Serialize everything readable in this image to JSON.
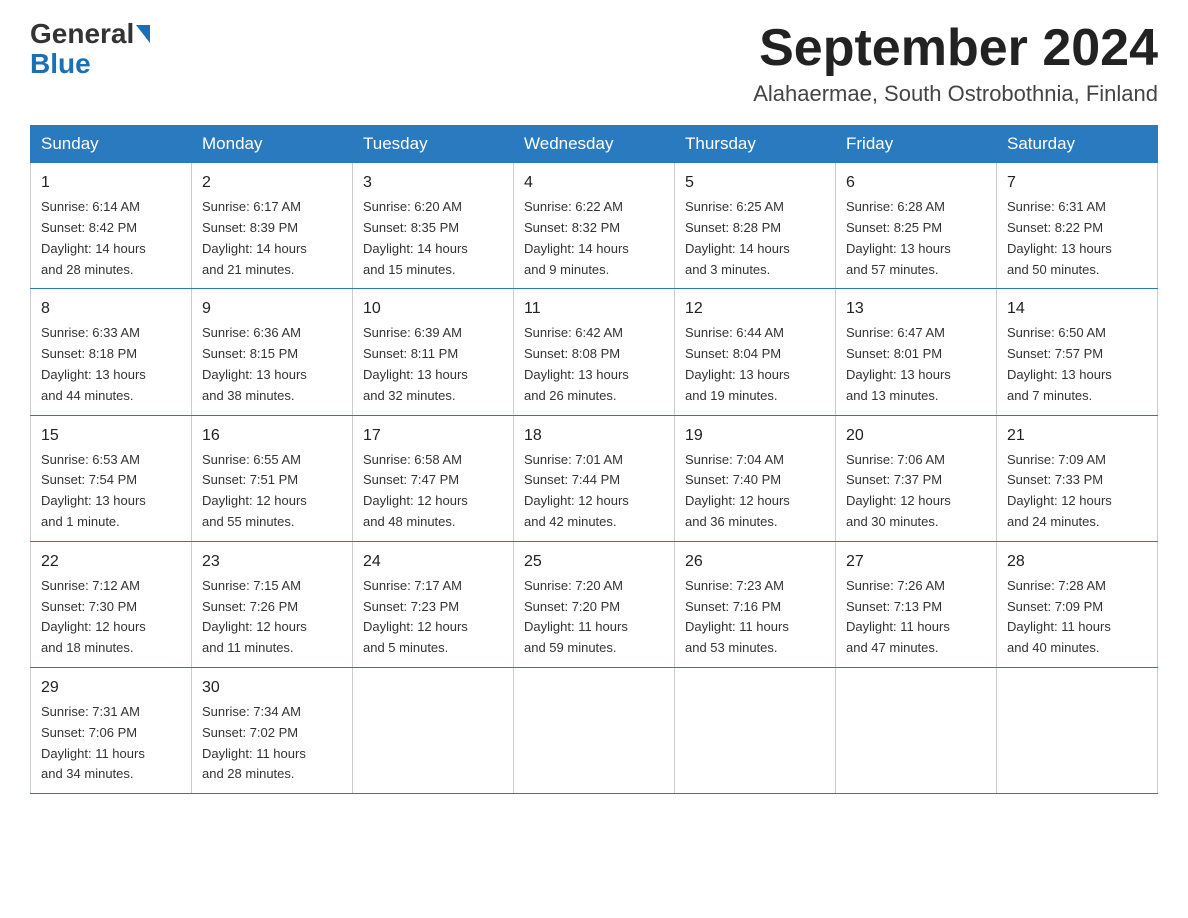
{
  "header": {
    "logo_general": "General",
    "logo_blue": "Blue",
    "month_title": "September 2024",
    "location": "Alahaermae, South Ostrobothnia, Finland"
  },
  "days_of_week": [
    "Sunday",
    "Monday",
    "Tuesday",
    "Wednesday",
    "Thursday",
    "Friday",
    "Saturday"
  ],
  "weeks": [
    [
      {
        "day": "1",
        "sunrise": "6:14 AM",
        "sunset": "8:42 PM",
        "daylight": "14 hours and 28 minutes."
      },
      {
        "day": "2",
        "sunrise": "6:17 AM",
        "sunset": "8:39 PM",
        "daylight": "14 hours and 21 minutes."
      },
      {
        "day": "3",
        "sunrise": "6:20 AM",
        "sunset": "8:35 PM",
        "daylight": "14 hours and 15 minutes."
      },
      {
        "day": "4",
        "sunrise": "6:22 AM",
        "sunset": "8:32 PM",
        "daylight": "14 hours and 9 minutes."
      },
      {
        "day": "5",
        "sunrise": "6:25 AM",
        "sunset": "8:28 PM",
        "daylight": "14 hours and 3 minutes."
      },
      {
        "day": "6",
        "sunrise": "6:28 AM",
        "sunset": "8:25 PM",
        "daylight": "13 hours and 57 minutes."
      },
      {
        "day": "7",
        "sunrise": "6:31 AM",
        "sunset": "8:22 PM",
        "daylight": "13 hours and 50 minutes."
      }
    ],
    [
      {
        "day": "8",
        "sunrise": "6:33 AM",
        "sunset": "8:18 PM",
        "daylight": "13 hours and 44 minutes."
      },
      {
        "day": "9",
        "sunrise": "6:36 AM",
        "sunset": "8:15 PM",
        "daylight": "13 hours and 38 minutes."
      },
      {
        "day": "10",
        "sunrise": "6:39 AM",
        "sunset": "8:11 PM",
        "daylight": "13 hours and 32 minutes."
      },
      {
        "day": "11",
        "sunrise": "6:42 AM",
        "sunset": "8:08 PM",
        "daylight": "13 hours and 26 minutes."
      },
      {
        "day": "12",
        "sunrise": "6:44 AM",
        "sunset": "8:04 PM",
        "daylight": "13 hours and 19 minutes."
      },
      {
        "day": "13",
        "sunrise": "6:47 AM",
        "sunset": "8:01 PM",
        "daylight": "13 hours and 13 minutes."
      },
      {
        "day": "14",
        "sunrise": "6:50 AM",
        "sunset": "7:57 PM",
        "daylight": "13 hours and 7 minutes."
      }
    ],
    [
      {
        "day": "15",
        "sunrise": "6:53 AM",
        "sunset": "7:54 PM",
        "daylight": "13 hours and 1 minute."
      },
      {
        "day": "16",
        "sunrise": "6:55 AM",
        "sunset": "7:51 PM",
        "daylight": "12 hours and 55 minutes."
      },
      {
        "day": "17",
        "sunrise": "6:58 AM",
        "sunset": "7:47 PM",
        "daylight": "12 hours and 48 minutes."
      },
      {
        "day": "18",
        "sunrise": "7:01 AM",
        "sunset": "7:44 PM",
        "daylight": "12 hours and 42 minutes."
      },
      {
        "day": "19",
        "sunrise": "7:04 AM",
        "sunset": "7:40 PM",
        "daylight": "12 hours and 36 minutes."
      },
      {
        "day": "20",
        "sunrise": "7:06 AM",
        "sunset": "7:37 PM",
        "daylight": "12 hours and 30 minutes."
      },
      {
        "day": "21",
        "sunrise": "7:09 AM",
        "sunset": "7:33 PM",
        "daylight": "12 hours and 24 minutes."
      }
    ],
    [
      {
        "day": "22",
        "sunrise": "7:12 AM",
        "sunset": "7:30 PM",
        "daylight": "12 hours and 18 minutes."
      },
      {
        "day": "23",
        "sunrise": "7:15 AM",
        "sunset": "7:26 PM",
        "daylight": "12 hours and 11 minutes."
      },
      {
        "day": "24",
        "sunrise": "7:17 AM",
        "sunset": "7:23 PM",
        "daylight": "12 hours and 5 minutes."
      },
      {
        "day": "25",
        "sunrise": "7:20 AM",
        "sunset": "7:20 PM",
        "daylight": "11 hours and 59 minutes."
      },
      {
        "day": "26",
        "sunrise": "7:23 AM",
        "sunset": "7:16 PM",
        "daylight": "11 hours and 53 minutes."
      },
      {
        "day": "27",
        "sunrise": "7:26 AM",
        "sunset": "7:13 PM",
        "daylight": "11 hours and 47 minutes."
      },
      {
        "day": "28",
        "sunrise": "7:28 AM",
        "sunset": "7:09 PM",
        "daylight": "11 hours and 40 minutes."
      }
    ],
    [
      {
        "day": "29",
        "sunrise": "7:31 AM",
        "sunset": "7:06 PM",
        "daylight": "11 hours and 34 minutes."
      },
      {
        "day": "30",
        "sunrise": "7:34 AM",
        "sunset": "7:02 PM",
        "daylight": "11 hours and 28 minutes."
      },
      null,
      null,
      null,
      null,
      null
    ]
  ],
  "labels": {
    "sunrise": "Sunrise:",
    "sunset": "Sunset:",
    "daylight": "Daylight:"
  }
}
